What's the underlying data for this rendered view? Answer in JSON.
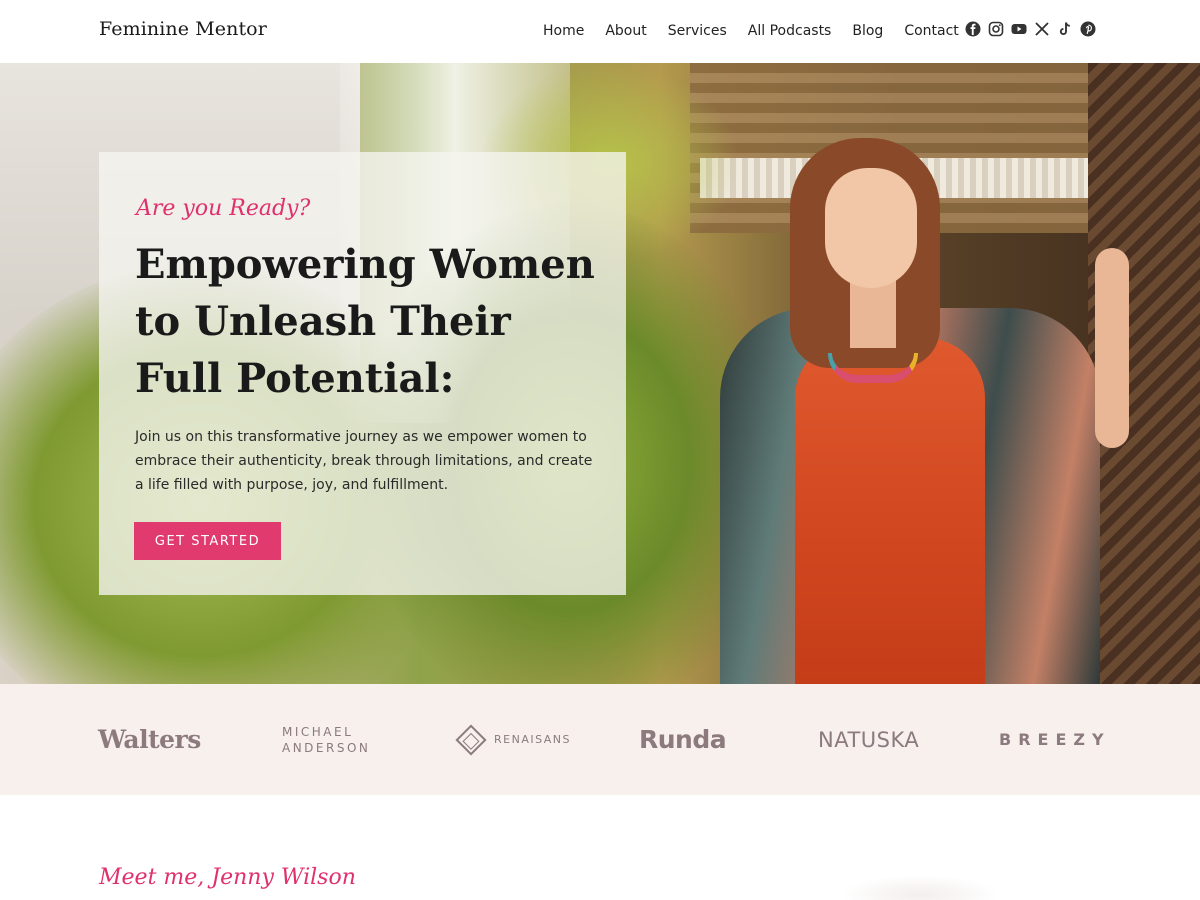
{
  "header": {
    "site_title": "Feminine Mentor",
    "nav": [
      "Home",
      "About",
      "Services",
      "All Podcasts",
      "Blog",
      "Contact"
    ],
    "social_icons": [
      "facebook-icon",
      "instagram-icon",
      "youtube-icon",
      "x-icon",
      "tiktok-icon",
      "pinterest-icon"
    ]
  },
  "hero": {
    "tagline": "Are you Ready?",
    "title": "Empowering Women to Unleash Their Full Potential:",
    "description": "Join us on this transformative journey as we empower women to embrace their authenticity, break through limitations, and create a life filled with purpose, joy, and fulfillment.",
    "cta_label": "GET STARTED"
  },
  "brands": {
    "walters": "Walters",
    "michael_line1": "MICHAEL",
    "michael_line2": "ANDERSON",
    "renaisans": "RENAISANS",
    "runda": "Runda",
    "natuska": "NATUSKA",
    "breezy": "BREEZY"
  },
  "meet": {
    "heading": "Meet me, Jenny Wilson"
  },
  "colors": {
    "accent": "#e03a6f",
    "logo_strip_bg": "#f7f0ed",
    "brand_gray": "#8c7a7e"
  }
}
